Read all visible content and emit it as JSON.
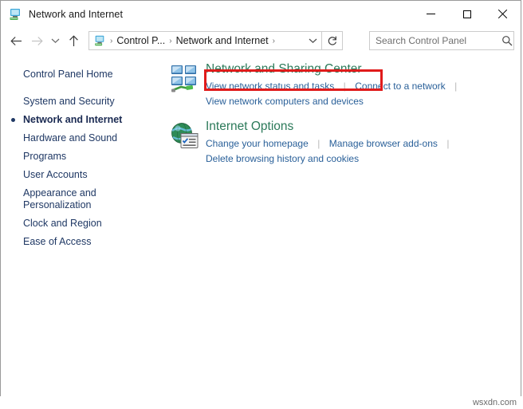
{
  "window": {
    "title": "Network and Internet",
    "title_icon": "network-computer-icon",
    "minimize_label": "Minimize",
    "maximize_label": "Maximize",
    "close_label": "Close"
  },
  "toolbar": {
    "back_label": "←",
    "forward_label": "→",
    "recent_label": "⌄",
    "up_label": "↑",
    "refresh_label": "↻",
    "dropdown_label": "⌄"
  },
  "breadcrumb": {
    "icon": "control-panel-icon",
    "items": [
      {
        "label": "Control P..."
      },
      {
        "label": "Network and Internet"
      }
    ],
    "separator": "›"
  },
  "search": {
    "placeholder": "Search Control Panel",
    "value": "",
    "icon": "search-icon"
  },
  "sidebar": {
    "items": [
      {
        "label": "Control Panel Home",
        "active": false,
        "gap_after": true
      },
      {
        "label": "System and Security",
        "active": false,
        "gap_after": false
      },
      {
        "label": "Network and Internet",
        "active": true,
        "gap_after": false
      },
      {
        "label": "Hardware and Sound",
        "active": false,
        "gap_after": false
      },
      {
        "label": "Programs",
        "active": false,
        "gap_after": false
      },
      {
        "label": "User Accounts",
        "active": false,
        "gap_after": false
      },
      {
        "label": "Appearance and\nPersonalization",
        "active": false,
        "gap_after": false
      },
      {
        "label": "Clock and Region",
        "active": false,
        "gap_after": false
      },
      {
        "label": "Ease of Access",
        "active": false,
        "gap_after": false
      }
    ]
  },
  "main": {
    "categories": [
      {
        "icon": "network-sharing-center-icon",
        "title": "Network and Sharing Center",
        "title_color": "#2c7a5a",
        "highlighted": true,
        "link_rows": [
          {
            "links": [
              "View network status and tasks",
              "Connect to a network"
            ],
            "trailing_separator": true
          },
          {
            "links": [
              "View network computers and devices"
            ],
            "trailing_separator": false
          }
        ]
      },
      {
        "icon": "internet-options-icon",
        "title": "Internet Options",
        "title_color": "#2c7a5a",
        "highlighted": false,
        "link_rows": [
          {
            "links": [
              "Change your homepage",
              "Manage browser add-ons"
            ],
            "trailing_separator": true
          },
          {
            "links": [
              "Delete browsing history and cookies"
            ],
            "trailing_separator": false
          }
        ]
      }
    ]
  },
  "annotation": {
    "color": "#e01b1b",
    "target": "Network and Sharing Center"
  },
  "watermark": {
    "text": "wsxdn.com"
  }
}
